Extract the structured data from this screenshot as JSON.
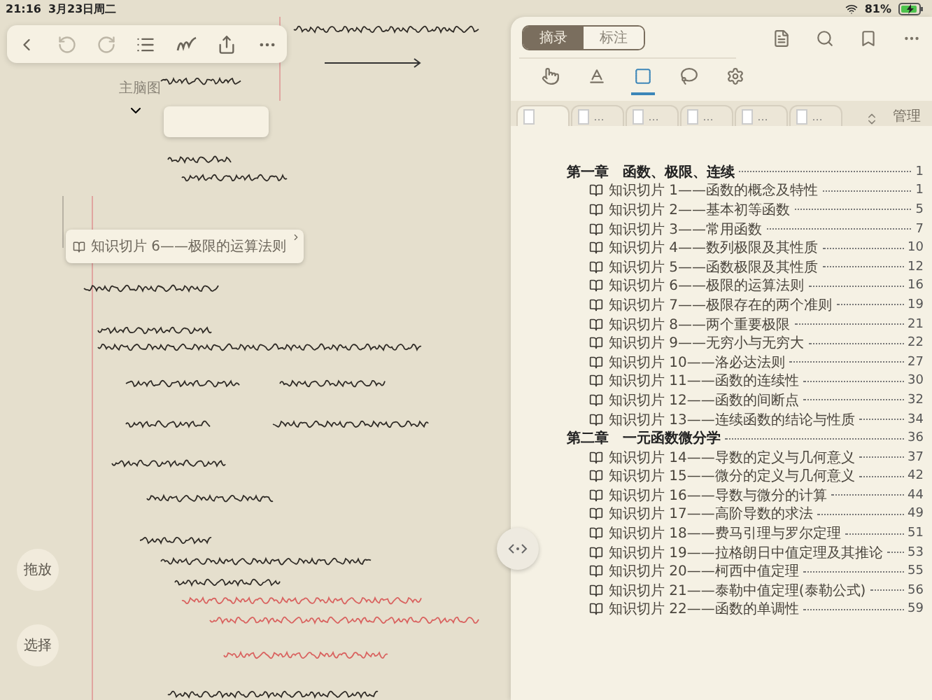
{
  "status_bar": {
    "time": "21:16",
    "date": "3月23日周二",
    "battery": "81%",
    "charging": true
  },
  "note_toolbar": [
    {
      "kind": "back",
      "disabled": false
    },
    {
      "kind": "undo",
      "disabled": true
    },
    {
      "kind": "redo",
      "disabled": true
    },
    {
      "kind": "list",
      "disabled": false
    },
    {
      "kind": "pen",
      "disabled": false
    },
    {
      "kind": "share",
      "disabled": false
    },
    {
      "kind": "more",
      "disabled": false
    }
  ],
  "canvas": {
    "mind_map_label": "主脑图",
    "link_card": "知识切片 6——极限的运算法则"
  },
  "side_buttons": [
    "拖放",
    "选择"
  ],
  "panel": {
    "modes": [
      {
        "label": "摘录",
        "selected": true
      },
      {
        "label": "标注",
        "selected": false
      }
    ],
    "tools": [
      {
        "kind": "hand",
        "selected": false
      },
      {
        "kind": "text",
        "selected": false
      },
      {
        "kind": "frame",
        "selected": true
      },
      {
        "kind": "lasso",
        "selected": false
      },
      {
        "kind": "settings",
        "selected": false
      }
    ],
    "tabs": [
      {
        "selected": true
      },
      {
        "label": "…",
        "selected": false
      },
      {
        "label": "…",
        "selected": false
      },
      {
        "label": "…",
        "selected": false
      },
      {
        "label": "…",
        "selected": false
      },
      {
        "label": "…",
        "selected": false
      }
    ],
    "manage": "管理"
  },
  "toc": [
    {
      "kind": "chapter",
      "title": "第一章　函数、极限、连续",
      "page": "1"
    },
    {
      "kind": "section",
      "title": "知识切片 1——函数的概念及特性",
      "page": "1"
    },
    {
      "kind": "section",
      "title": "知识切片 2——基本初等函数",
      "page": "5"
    },
    {
      "kind": "section",
      "title": "知识切片 3——常用函数",
      "page": "7"
    },
    {
      "kind": "section",
      "title": "知识切片 4——数列极限及其性质",
      "page": "10"
    },
    {
      "kind": "section",
      "title": "知识切片 5——函数极限及其性质",
      "page": "12"
    },
    {
      "kind": "section",
      "title": "知识切片 6——极限的运算法则",
      "page": "16"
    },
    {
      "kind": "section",
      "title": "知识切片 7——极限存在的两个准则",
      "page": "19"
    },
    {
      "kind": "section",
      "title": "知识切片 8——两个重要极限",
      "page": "21"
    },
    {
      "kind": "section",
      "title": "知识切片 9——无穷小与无穷大",
      "page": "22"
    },
    {
      "kind": "section",
      "title": "知识切片 10——洛必达法则",
      "page": "27"
    },
    {
      "kind": "section",
      "title": "知识切片 11——函数的连续性",
      "page": "30"
    },
    {
      "kind": "section",
      "title": "知识切片 12——函数的间断点",
      "page": "32"
    },
    {
      "kind": "section",
      "title": "知识切片 13——连续函数的结论与性质",
      "page": "34"
    },
    {
      "kind": "chapter",
      "title": "第二章　一元函数微分学",
      "page": "36"
    },
    {
      "kind": "section",
      "title": "知识切片 14——导数的定义与几何意义",
      "page": "37"
    },
    {
      "kind": "section",
      "title": "知识切片 15——微分的定义与几何意义",
      "page": "42"
    },
    {
      "kind": "section",
      "title": "知识切片 16——导数与微分的计算",
      "page": "44"
    },
    {
      "kind": "section",
      "title": "知识切片 17——高阶导数的求法",
      "page": "49"
    },
    {
      "kind": "section",
      "title": "知识切片 18——费马引理与罗尔定理",
      "page": "51"
    },
    {
      "kind": "section",
      "title": "知识切片 19——拉格朗日中值定理及其推论",
      "page": "53"
    },
    {
      "kind": "section",
      "title": "知识切片 20——柯西中值定理",
      "page": "55"
    },
    {
      "kind": "section",
      "title": "知识切片 21——泰勒中值定理(泰勒公式)",
      "page": "56"
    },
    {
      "kind": "section",
      "title": "知识切片 22——函数的单调性",
      "page": "59"
    }
  ]
}
